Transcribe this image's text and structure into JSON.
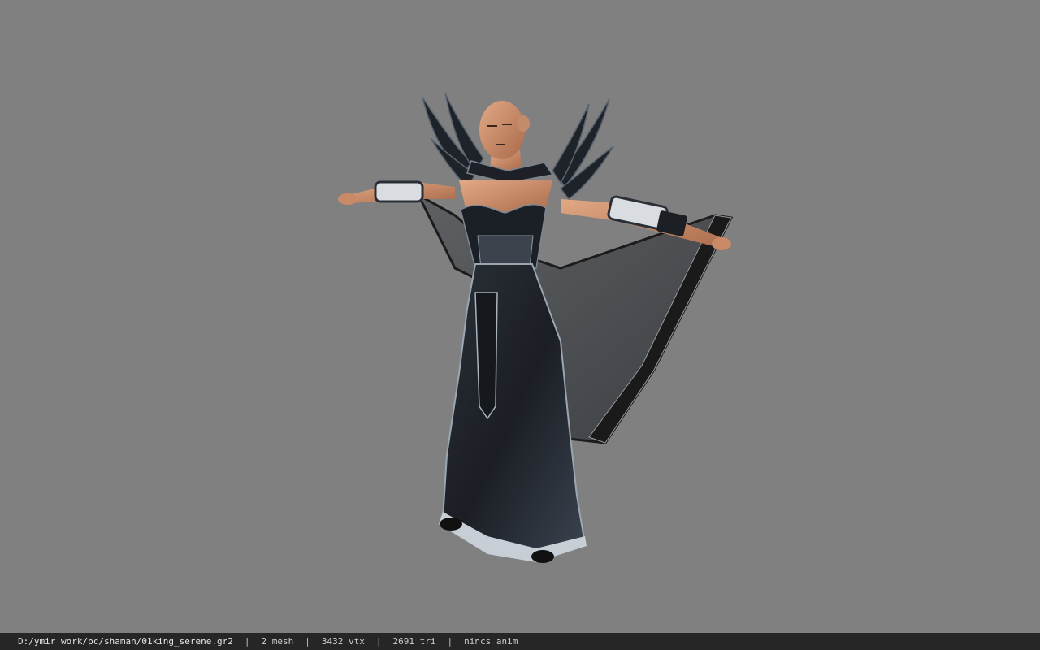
{
  "viewer": {
    "background_color": "#808080",
    "model_name": "shaman character model (T-pose)"
  },
  "status_bar": {
    "path": "D:/ymir work/pc/shaman/01king_serene.gr2",
    "separator": "|",
    "mesh": "2 mesh",
    "vtx": "3432 vtx",
    "tri": "2691 tri",
    "anim": "nincs anim"
  }
}
